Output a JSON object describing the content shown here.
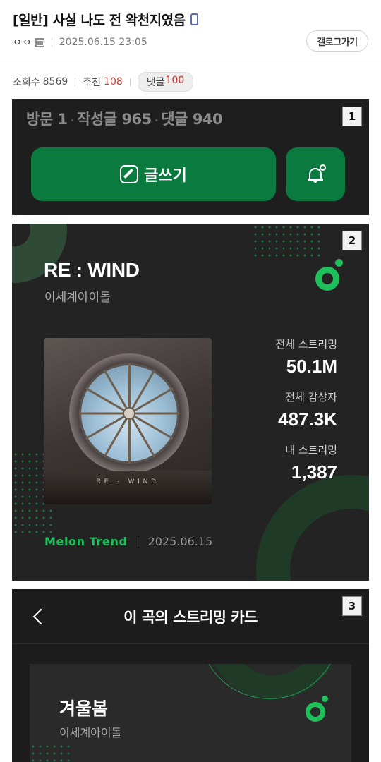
{
  "post": {
    "title": "[일반] 사실 나도 전 왁천지였음",
    "author": "ㅇㅇ",
    "datetime": "2025.06.15 23:05",
    "gallery_button": "갤로그가기",
    "stats": {
      "views_label": "조회수",
      "views": "8569",
      "recommend_label": "추천",
      "recommend": "108",
      "comments_label": "댓글",
      "comments": "100"
    }
  },
  "panel1": {
    "number": "1",
    "visit_label": "방문",
    "visit": "1",
    "posts_label": "작성글",
    "posts": "965",
    "comments_label": "댓글",
    "comments": "940",
    "write_button": "글쓰기"
  },
  "panel2": {
    "number": "2",
    "song_title": "RE : WIND",
    "artist": "이세계아이돌",
    "album_label": "RE · WIND",
    "stats": [
      {
        "label": "전체 스트리밍",
        "value": "50.1M"
      },
      {
        "label": "전체 감상자",
        "value": "487.3K"
      },
      {
        "label": "내 스트리밍",
        "value": "1,387"
      }
    ],
    "trend_brand": "Melon Trend",
    "trend_date": "2025.06.15"
  },
  "panel3": {
    "number": "3",
    "header_title": "이 곡의 스트리밍 카드",
    "card_title": "겨울봄",
    "card_artist": "이세계아이돌"
  },
  "colors": {
    "melon_green": "#1fc05b",
    "button_green": "#0a7a3e",
    "panel_bg": "#232323",
    "accent_red": "#c0392b"
  },
  "icons": [
    "phone-icon",
    "pen-icon",
    "bell-settings-icon",
    "melon-logo-icon",
    "back-icon"
  ]
}
